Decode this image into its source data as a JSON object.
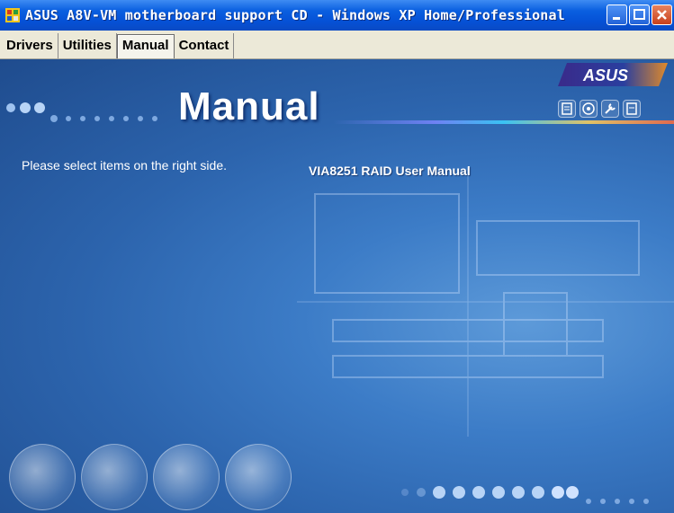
{
  "window": {
    "title": "ASUS A8V-VM motherboard support CD - Windows XP Home/Professional",
    "icon": "asus-app-icon"
  },
  "tabs": [
    {
      "label": "Drivers",
      "active": false
    },
    {
      "label": "Utilities",
      "active": false
    },
    {
      "label": "Manual",
      "active": true
    },
    {
      "label": "Contact",
      "active": false
    }
  ],
  "banner": {
    "title": "Manual",
    "logo": "ASUS"
  },
  "left_panel": {
    "instruction": "Please select items on the right side."
  },
  "items": [
    {
      "label": "VIA8251 RAID User Manual"
    }
  ],
  "toolbar_icons": [
    "document-icon",
    "cd-icon",
    "wrench-icon",
    "notes-icon"
  ],
  "colors": {
    "titlebar": "#0a5fe0",
    "tabbar": "#ece9d8",
    "content_bg": "#3c7cc7",
    "text": "#ffffff"
  }
}
